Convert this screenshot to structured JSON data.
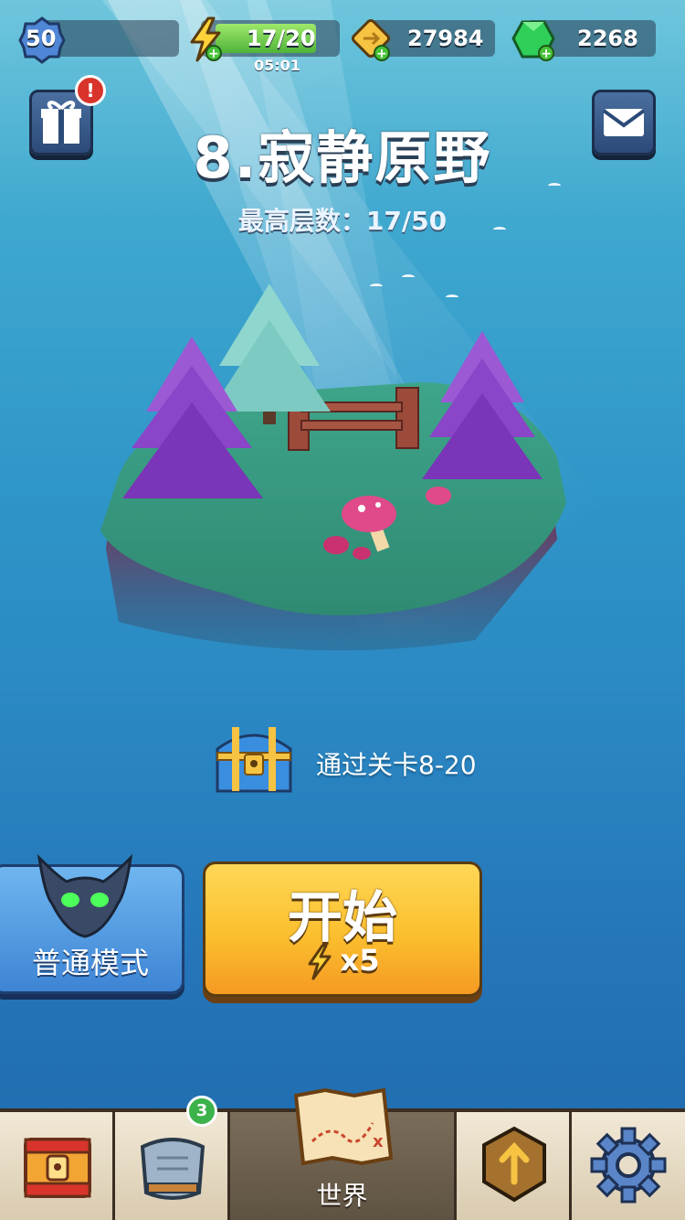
{
  "topbar": {
    "player_level": "50",
    "energy": "17/20",
    "energy_timer": "05:01",
    "coins": "27984",
    "gems": "2268"
  },
  "header": {
    "gift_alert": "!",
    "title": "8.寂静原野",
    "subtitle": "最高层数：17/50"
  },
  "reward": {
    "text": "通过关卡8-20"
  },
  "actions": {
    "mode_label": "普通模式",
    "start_label": "开始",
    "start_cost": "x5"
  },
  "bottom_nav": {
    "armor_badge": "3",
    "world_label": "世界"
  },
  "colors": {
    "ocean_top": "#6ec6dc",
    "ocean_bottom": "#1f6aac",
    "start_button": "#fbbf2e",
    "mode_button": "#3d84d4",
    "energy_green": "#4fb43a",
    "gem_green": "#2fcf5a",
    "notification_red": "#d9342b"
  },
  "icons": [
    "level-badge-icon",
    "lightning-icon",
    "ticket-icon",
    "gem-icon",
    "gift-icon",
    "mail-icon",
    "treasure-chest-icon",
    "demon-mask-icon",
    "chest-nav-icon",
    "armor-icon",
    "map-icon",
    "upgrade-arrow-icon",
    "gear-icon"
  ]
}
